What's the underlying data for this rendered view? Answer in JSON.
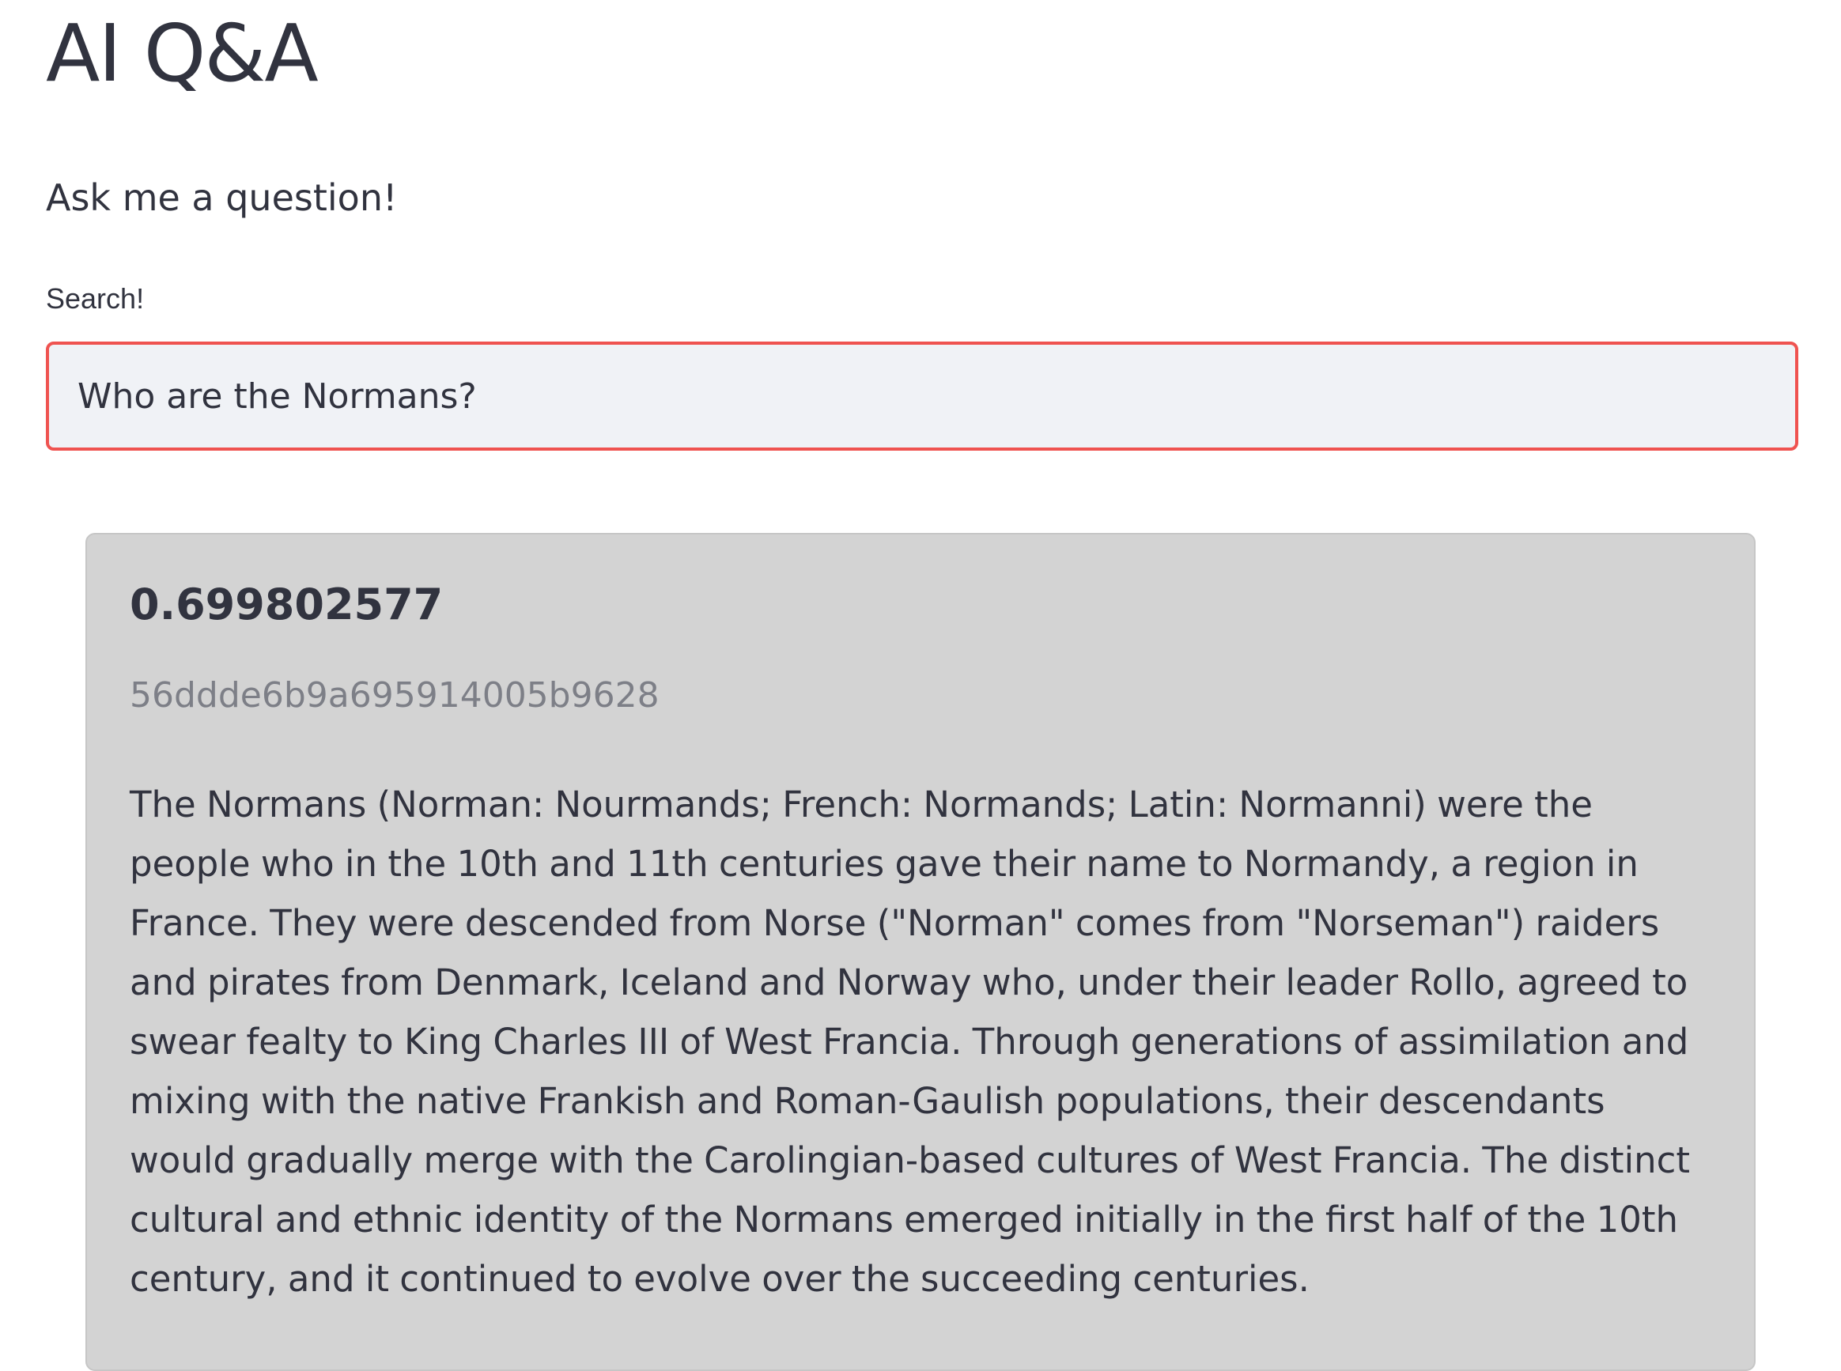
{
  "app": {
    "title": "AI Q&A",
    "subtitle": "Ask me a question!"
  },
  "search": {
    "label": "Search!",
    "value": "Who are the Normans?"
  },
  "result": {
    "score": "0.699802577",
    "id": "56ddde6b9a695914005b9628",
    "answer": "The Normans (Norman: Nourmands; French: Normands; Latin: Normanni) were the people who in the 10th and 11th centuries gave their name to Normandy, a region in France. They were descended from Norse (\"Norman\" comes from \"Norseman\") raiders and pirates from Denmark, Iceland and Norway who, under their leader Rollo, agreed to swear fealty to King Charles III of West Francia. Through generations of assimilation and mixing with the native Frankish and Roman-Gaulish populations, their descendants would gradually merge with the Carolingian-based cultures of West Francia. The distinct cultural and ethnic identity of the Normans emerged initially in the first half of the 10th century, and it continued to evolve over the succeeding centuries."
  },
  "colors": {
    "text": "#31333f",
    "input_border": "#ef5350",
    "input_background": "#f0f2f6",
    "card_background": "#d3d3d3",
    "id_text": "#7d7f87"
  }
}
